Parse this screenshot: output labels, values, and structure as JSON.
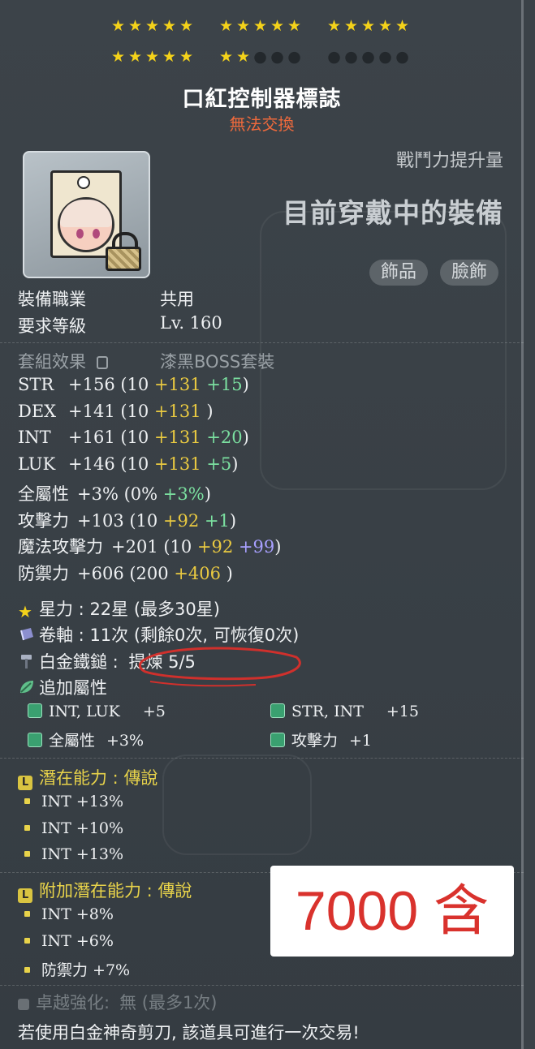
{
  "stars": {
    "row1": [
      [
        true,
        true,
        true,
        true,
        true
      ],
      [
        true,
        true,
        true,
        true,
        true
      ],
      [
        true,
        true,
        true,
        true,
        true
      ]
    ],
    "row2": [
      [
        true,
        true,
        true,
        true,
        true
      ],
      [
        true,
        true,
        false,
        false,
        false
      ],
      [
        false,
        false,
        false,
        false,
        false
      ]
    ],
    "filled_count": 22,
    "max": 30
  },
  "item": {
    "name": "口紅控制器標誌",
    "trade_status": "無法交換",
    "boost_label": "戰鬥力提升量",
    "current_equip": "目前穿戴中的裝備",
    "categories": [
      "飾品",
      "臉飾"
    ]
  },
  "requirements": {
    "job_label": "裝備職業",
    "job_value": "共用",
    "level_label": "要求等級",
    "level_value": "Lv. 160"
  },
  "set": {
    "label": "套組效果",
    "value": "漆黑BOSS套裝"
  },
  "stats": [
    {
      "name": "STR",
      "total": "+156",
      "base": "10",
      "scroll": "+131",
      "bonus": "+15",
      "bonus_color": "green"
    },
    {
      "name": "DEX",
      "total": "+141",
      "base": "10",
      "scroll": "+131",
      "bonus": "",
      "bonus_color": "green"
    },
    {
      "name": "INT",
      "total": "+161",
      "base": "10",
      "scroll": "+131",
      "bonus": "+20",
      "bonus_color": "green"
    },
    {
      "name": "LUK",
      "total": "+146",
      "base": "10",
      "scroll": "+131",
      "bonus": "+5",
      "bonus_color": "green"
    },
    {
      "name": "全屬性",
      "total": "+3%",
      "base": "0%",
      "scroll": "",
      "bonus": "+3%",
      "bonus_color": "green"
    },
    {
      "name": "攻擊力",
      "total": "+103",
      "base": "10",
      "scroll": "+92",
      "bonus": "+1",
      "bonus_color": "green"
    },
    {
      "name": "魔法攻擊力",
      "total": "+201",
      "base": "10",
      "scroll": "+92",
      "bonus": "+99",
      "bonus_color": "purple"
    },
    {
      "name": "防禦力",
      "total": "+606",
      "base": "200",
      "scroll": "+406",
      "bonus": "",
      "bonus_color": "green"
    }
  ],
  "starforce": {
    "label": "星力",
    "value": "22星 (最多30星)"
  },
  "scroll": {
    "label": "卷軸",
    "value": "11次 (剩餘0次, 可恢復0次)"
  },
  "hammer": {
    "label": "白金鐵鎚",
    "value": "提煉 5/5"
  },
  "flame": {
    "label": "追加屬性",
    "items": [
      {
        "text": "INT, LUK",
        "value": "+5"
      },
      {
        "text": "STR, INT",
        "value": "+15"
      },
      {
        "text": "全屬性",
        "value": "+3%"
      },
      {
        "text": "攻擊力",
        "value": "+1"
      }
    ]
  },
  "potential": {
    "badge": "L",
    "label": "潛在能力",
    "grade": "傳說",
    "lines": [
      "INT +13%",
      "INT +10%",
      "INT +13%"
    ]
  },
  "bonus_potential": {
    "badge": "L",
    "label": "附加潛在能力",
    "grade": "傳說",
    "lines": [
      "INT +8%",
      "INT +6%",
      "防禦力 +7%"
    ]
  },
  "exceptional": {
    "label": "卓越強化:",
    "value": "無 (最多1次)"
  },
  "footer": "若使用白金神奇剪刀, 該道具可進行一次交易!",
  "price_tag": "7000 含",
  "colors": {
    "star_on": "#f4d21a",
    "untradeable": "#f06a3c",
    "scroll_bonus": "#e9c941",
    "flame_bonus": "#7be0a0",
    "magic_bonus": "#a8a0ff",
    "potential": "#e8d34a",
    "price": "#d9322d",
    "annotation": "#d0302c"
  }
}
